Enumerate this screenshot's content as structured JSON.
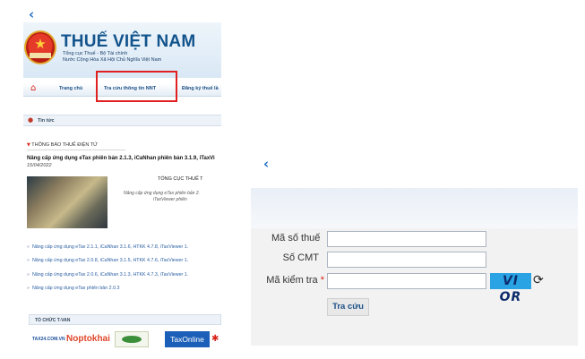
{
  "left_panel": {
    "back_icon": "chevron-left",
    "site": {
      "title": "THUẾ VIỆT NAM",
      "subtitle1": "Tổng cục Thuế - Bộ Tài chính",
      "subtitle2": "Nước Cộng Hòa Xã Hội Chủ Nghĩa Việt Nam"
    },
    "nav": {
      "home": "Trang chủ",
      "lookup": "Tra cứu thông tin NNT",
      "register": "Đăng ký thuế lầ"
    },
    "news_header": "Tin tức",
    "ebox_title": "THÔNG BÁO THUẾ ĐIỆN TỬ",
    "headline": "Nâng cấp ứng dụng eTax phiên bản 2.1.3, iCaNhan phiên bản 3.1.9, iTaxVi",
    "headline_date": "15/04/2022",
    "article_org": "TỔNG CỤC THUẾ T",
    "article_snip1": "Nâng cấp ứng dụng eTax phiên bản 2.",
    "article_snip2": "iTaxViewer phiên",
    "news_links": [
      "Nâng cấp ứng dụng eTax 2.1.1, iCaNhan 3.1.6, HTKK 4.7.8, iTaxViewer 1.",
      "Nâng cấp ứng dụng eTax 2.0.8, iCaNhan 3.1.5, HTKK 4.7.6, iTaxViewer 1.",
      "Nâng cấp ứng dụng eTax 2.0.6, iCaNhan 3.1.3, HTKK 4.7.3, iTaxViewer 1.",
      "Nâng cấp ứng dụng eTax phiên bản 2.0.3"
    ],
    "tvan_header": "TỔ CHỨC T-VAN",
    "tvan_logos": [
      "TAX24.COM.VN",
      "Noptokhai",
      "",
      "TaxOnline"
    ]
  },
  "right_panel": {
    "back_icon": "chevron-left",
    "labels": {
      "tax_code": "Mã số thuế",
      "id_card": "Số CMT",
      "captcha_code": "Mã kiểm tra",
      "required_mark": "*"
    },
    "values": {
      "tax_code": "",
      "id_card": "",
      "captcha_code": ""
    },
    "captcha_text": "VI OR",
    "submit_label": "Tra cứu"
  },
  "colors": {
    "accent_blue": "#1f6fc5",
    "brand_title": "#13548c",
    "highlight_red": "#e02020",
    "captcha_bg": "#2aa3e4"
  }
}
